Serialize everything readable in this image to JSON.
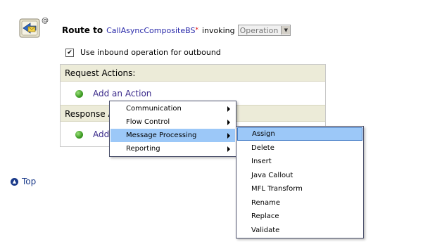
{
  "route": {
    "at_sign": "@",
    "label": "Route to",
    "service": "CallAsyncCompositeBS",
    "required_mark": "*",
    "invoking": "invoking",
    "operation": "Operation"
  },
  "options": {
    "use_inbound_label": "Use inbound operation for outbound",
    "use_inbound_checked": true
  },
  "request": {
    "header": "Request Actions:",
    "add_label": "Add an Action"
  },
  "response": {
    "header": "Response Ac",
    "add_label": "Add"
  },
  "top_link": "Top",
  "action_menu": [
    {
      "label": "Communication",
      "has_submenu": true
    },
    {
      "label": "Flow Control",
      "has_submenu": true
    },
    {
      "label": "Message Processing",
      "has_submenu": true,
      "selected": true
    },
    {
      "label": "Reporting",
      "has_submenu": true
    }
  ],
  "sub_menu": [
    {
      "label": "Assign",
      "selected": true
    },
    {
      "label": "Delete"
    },
    {
      "label": "Insert"
    },
    {
      "label": "Java Callout"
    },
    {
      "label": "MFL Transform"
    },
    {
      "label": "Rename"
    },
    {
      "label": "Replace"
    },
    {
      "label": "Validate"
    }
  ],
  "colors": {
    "header_bg": "#ecebd8",
    "menu_highlight": "#9cc8f8",
    "link": "#2a2aaa",
    "required": "#dd0000"
  }
}
